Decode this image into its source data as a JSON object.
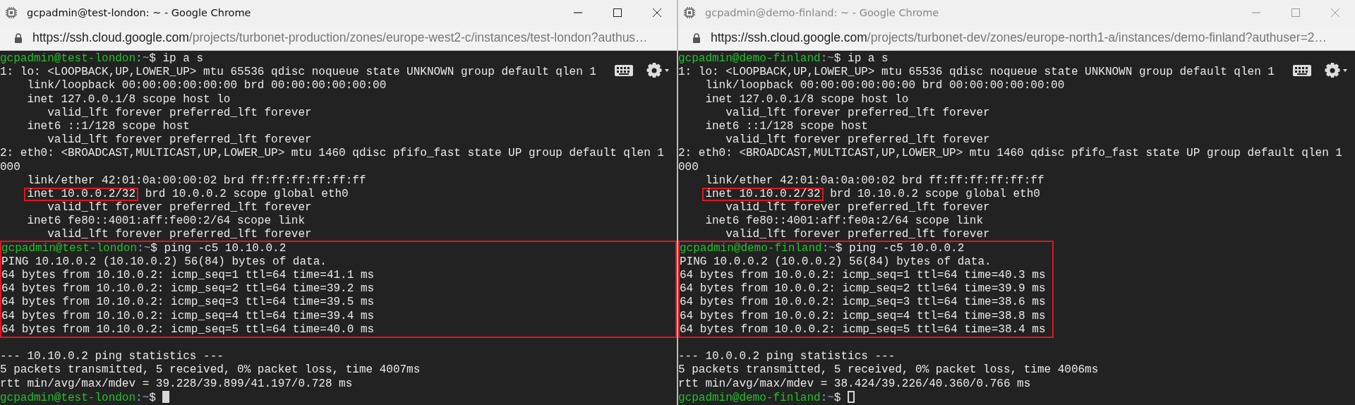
{
  "windows": [
    {
      "title": "gcpadmin@test-london: ~ - Google Chrome",
      "active": true,
      "url_host": "https://ssh.cloud.google.com",
      "url_path": "/projects/turbonet-production/zones/europe-west2-c/instances/test-london?authus…",
      "terminal_focused": true,
      "lines": [
        {
          "kind": "prompt",
          "host": "gcpadmin@test-london",
          "path": ":~",
          "command": "$ ip a s"
        },
        {
          "kind": "output",
          "text": "1: lo: <LOOPBACK,UP,LOWER_UP> mtu 65536 qdisc noqueue state UNKNOWN group default qlen 1"
        },
        {
          "kind": "output",
          "text": "    link/loopback 00:00:00:00:00:00 brd 00:00:00:00:00:00"
        },
        {
          "kind": "output",
          "text": "    inet 127.0.0.1/8 scope host lo"
        },
        {
          "kind": "output",
          "text": "       valid_lft forever preferred_lft forever"
        },
        {
          "kind": "output",
          "text": "    inet6 ::1/128 scope host"
        },
        {
          "kind": "output",
          "text": "       valid_lft forever preferred_lft forever"
        },
        {
          "kind": "output",
          "text": "2: eth0: <BROADCAST,MULTICAST,UP,LOWER_UP> mtu 1460 qdisc pfifo_fast state UP group default qlen 1"
        },
        {
          "kind": "output",
          "text": "000"
        },
        {
          "kind": "output",
          "text": "    link/ether 42:01:0a:00:00:02 brd ff:ff:ff:ff:ff:ff"
        },
        {
          "kind": "marked",
          "marked": "inet 10.0.0.2/32",
          "post": " brd 10.0.0.2 scope global eth0"
        },
        {
          "kind": "output",
          "text": "       valid_lft forever preferred_lft forever"
        },
        {
          "kind": "output",
          "text": "    inet6 fe80::4001:aff:fe00:2/64 scope link"
        },
        {
          "kind": "output",
          "text": "       valid_lft forever preferred_lft forever"
        },
        {
          "kind": "box",
          "full_width": true,
          "lines": [
            {
              "kind": "prompt",
              "host": "gcpadmin@test-london",
              "path": ":~",
              "command": "$ ping -c5 10.10.0.2"
            },
            {
              "kind": "output",
              "text": "PING 10.10.0.2 (10.10.0.2) 56(84) bytes of data."
            },
            {
              "kind": "output",
              "text": "64 bytes from 10.10.0.2: icmp_seq=1 ttl=64 time=41.1 ms"
            },
            {
              "kind": "output",
              "text": "64 bytes from 10.10.0.2: icmp_seq=2 ttl=64 time=39.2 ms"
            },
            {
              "kind": "output",
              "text": "64 bytes from 10.10.0.2: icmp_seq=3 ttl=64 time=39.5 ms"
            },
            {
              "kind": "output",
              "text": "64 bytes from 10.10.0.2: icmp_seq=4 ttl=64 time=39.4 ms"
            },
            {
              "kind": "output",
              "text": "64 bytes from 10.10.0.2: icmp_seq=5 ttl=64 time=40.0 ms"
            }
          ]
        },
        {
          "kind": "blank"
        },
        {
          "kind": "output",
          "text": "--- 10.10.0.2 ping statistics ---"
        },
        {
          "kind": "output",
          "text": "5 packets transmitted, 5 received, 0% packet loss, time 4007ms"
        },
        {
          "kind": "output",
          "text": "rtt min/avg/max/mdev = 39.228/39.899/41.197/0.728 ms"
        },
        {
          "kind": "prompt",
          "host": "gcpadmin@test-london",
          "path": ":~",
          "command": "$ ",
          "cursor": true
        }
      ]
    },
    {
      "title": "gcpadmin@demo-finland: ~ - Google Chrome",
      "active": false,
      "url_host": "https://ssh.cloud.google.com",
      "url_path": "/projects/turbonet-dev/zones/europe-north1-a/instances/demo-finland?authuser=2…",
      "terminal_focused": false,
      "lines": [
        {
          "kind": "prompt",
          "host": "gcpadmin@demo-finland",
          "path": ":~",
          "command": "$ ip a s"
        },
        {
          "kind": "output",
          "text": "1: lo: <LOOPBACK,UP,LOWER_UP> mtu 65536 qdisc noqueue state UNKNOWN group default qlen 1"
        },
        {
          "kind": "output",
          "text": "    link/loopback 00:00:00:00:00:00 brd 00:00:00:00:00:00"
        },
        {
          "kind": "output",
          "text": "    inet 127.0.0.1/8 scope host lo"
        },
        {
          "kind": "output",
          "text": "       valid_lft forever preferred_lft forever"
        },
        {
          "kind": "output",
          "text": "    inet6 ::1/128 scope host"
        },
        {
          "kind": "output",
          "text": "       valid_lft forever preferred_lft forever"
        },
        {
          "kind": "output",
          "text": "2: eth0: <BROADCAST,MULTICAST,UP,LOWER_UP> mtu 1460 qdisc pfifo_fast state UP group default qlen 1"
        },
        {
          "kind": "output",
          "text": "000"
        },
        {
          "kind": "output",
          "text": "    link/ether 42:01:0a:0a:00:02 brd ff:ff:ff:ff:ff:ff"
        },
        {
          "kind": "marked",
          "marked": "inet 10.10.0.2/32",
          "post": " brd 10.10.0.2 scope global eth0"
        },
        {
          "kind": "output",
          "text": "       valid_lft forever preferred_lft forever"
        },
        {
          "kind": "output",
          "text": "    inet6 fe80::4001:aff:fe0a:2/64 scope link"
        },
        {
          "kind": "output",
          "text": "       valid_lft forever preferred_lft forever"
        },
        {
          "kind": "box",
          "full_width": false,
          "lines": [
            {
              "kind": "prompt",
              "host": "gcpadmin@demo-finland",
              "path": ":~",
              "command": "$ ping -c5 10.0.0.2"
            },
            {
              "kind": "output",
              "text": "PING 10.0.0.2 (10.0.0.2) 56(84) bytes of data."
            },
            {
              "kind": "output",
              "text": "64 bytes from 10.0.0.2: icmp_seq=1 ttl=64 time=40.3 ms"
            },
            {
              "kind": "output",
              "text": "64 bytes from 10.0.0.2: icmp_seq=2 ttl=64 time=39.9 ms"
            },
            {
              "kind": "output",
              "text": "64 bytes from 10.0.0.2: icmp_seq=3 ttl=64 time=38.6 ms"
            },
            {
              "kind": "output",
              "text": "64 bytes from 10.0.0.2: icmp_seq=4 ttl=64 time=38.8 ms"
            },
            {
              "kind": "output",
              "text": "64 bytes from 10.0.0.2: icmp_seq=5 ttl=64 time=38.4 ms"
            }
          ]
        },
        {
          "kind": "blank"
        },
        {
          "kind": "output",
          "text": "--- 10.0.0.2 ping statistics ---"
        },
        {
          "kind": "output",
          "text": "5 packets transmitted, 5 received, 0% packet loss, time 4006ms"
        },
        {
          "kind": "output",
          "text": "rtt min/avg/max/mdev = 38.424/39.226/40.360/0.766 ms"
        },
        {
          "kind": "prompt",
          "host": "gcpadmin@demo-finland",
          "path": ":~",
          "command": "$ ",
          "cursor": true
        }
      ]
    }
  ]
}
